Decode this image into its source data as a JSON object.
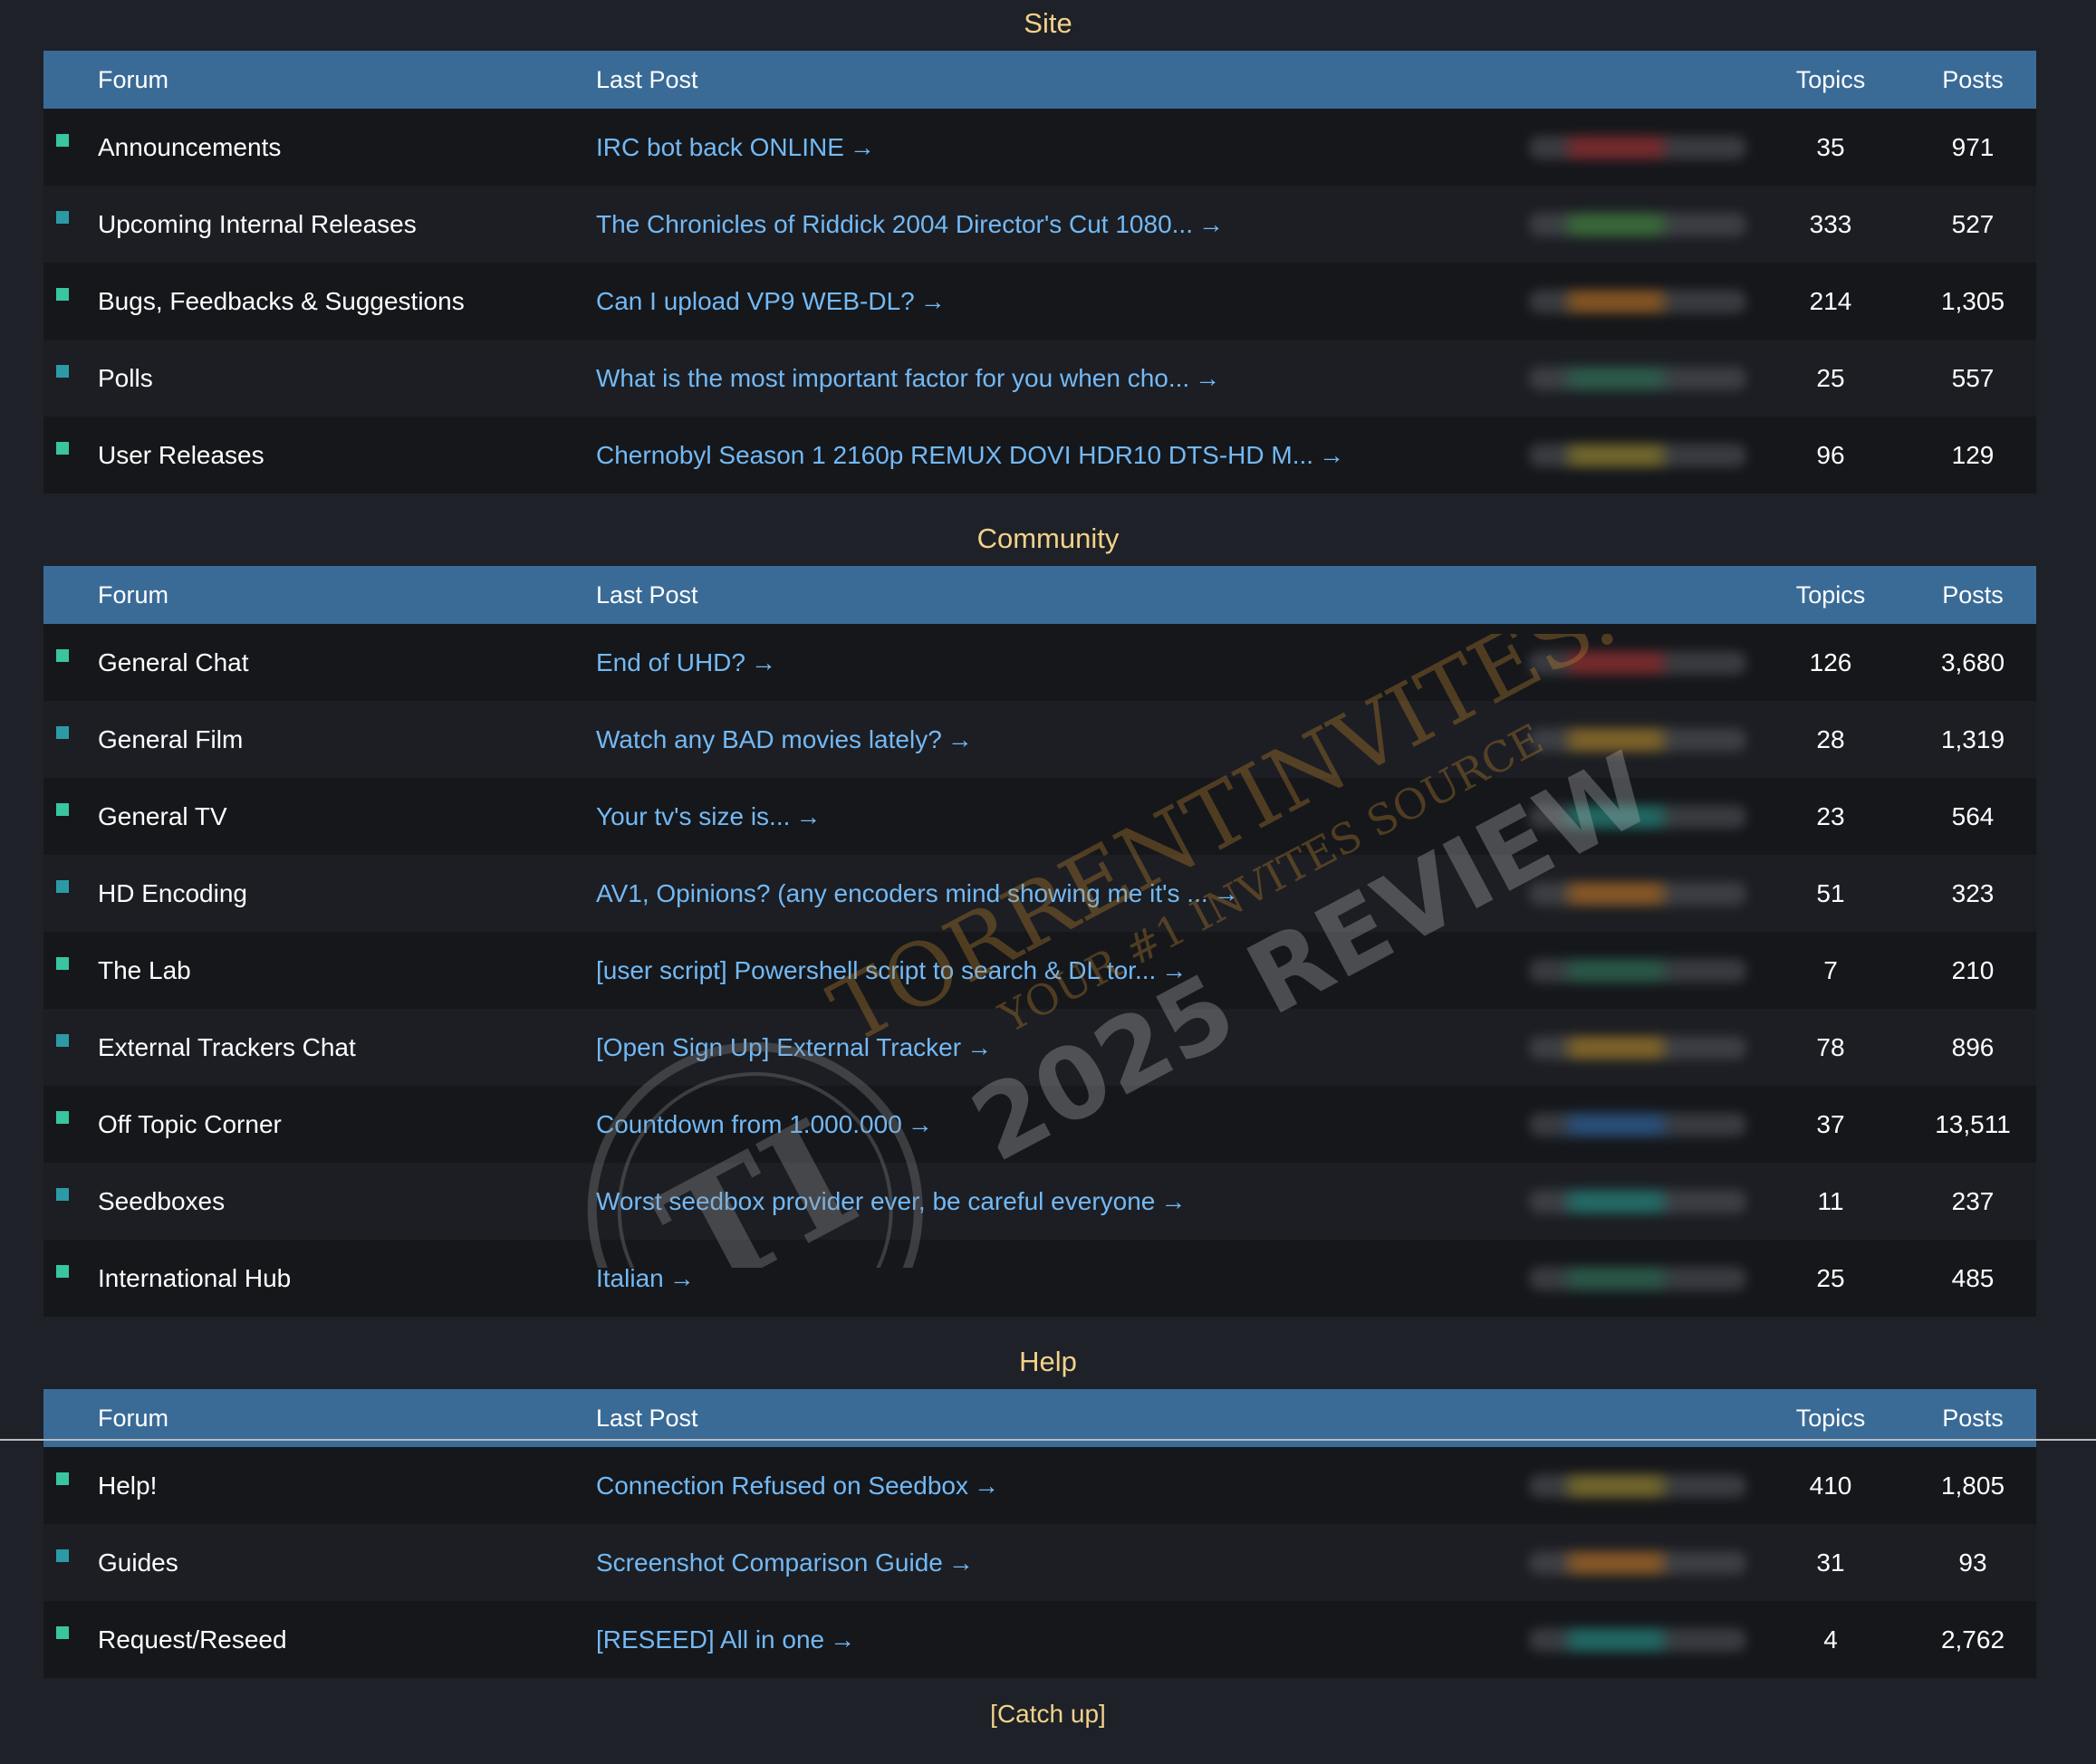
{
  "headers": {
    "forum": "Forum",
    "last_post": "Last Post",
    "topics": "Topics",
    "posts": "Posts"
  },
  "sections": [
    {
      "title": "Site",
      "rows": [
        {
          "forum": "Announcements",
          "last": "IRC bot back ONLINE",
          "topics": "35",
          "posts": "971",
          "blur": "#c23a3a"
        },
        {
          "forum": "Upcoming Internal Releases",
          "last": "The Chronicles of Riddick 2004 Director's Cut 1080...",
          "topics": "333",
          "posts": "527",
          "blur": "#4fa34a"
        },
        {
          "forum": "Bugs, Feedbacks & Suggestions",
          "last": "Can I upload VP9 WEB-DL?",
          "topics": "214",
          "posts": "1,305",
          "blur": "#d8842a"
        },
        {
          "forum": "Polls",
          "last": "What is the most important factor for you when cho...",
          "topics": "25",
          "posts": "557",
          "blur": "#3a8a6a"
        },
        {
          "forum": "User Releases",
          "last": "Chernobyl Season 1 2160p REMUX DOVI HDR10 DTS-HD M...",
          "topics": "96",
          "posts": "129",
          "blur": "#b8a23a"
        }
      ]
    },
    {
      "title": "Community",
      "rows": [
        {
          "forum": "General Chat",
          "last": "End of UHD?",
          "topics": "126",
          "posts": "3,680",
          "blur": "#c23a3a"
        },
        {
          "forum": "General Film",
          "last": "Watch any BAD movies lately?",
          "topics": "28",
          "posts": "1,319",
          "blur": "#c9982e"
        },
        {
          "forum": "General TV",
          "last": "Your tv's size is...",
          "topics": "23",
          "posts": "564",
          "blur": "#2aa69a"
        },
        {
          "forum": "HD Encoding",
          "last": "AV1, Opinions? (any encoders mind showing me it's ...",
          "topics": "51",
          "posts": "323",
          "blur": "#d8842a"
        },
        {
          "forum": "The Lab",
          "last": "[user script] Powershell script to search & DL tor...",
          "topics": "7",
          "posts": "210",
          "blur": "#3a8a6a"
        },
        {
          "forum": "External Trackers Chat",
          "last": "[Open Sign Up] External Tracker",
          "topics": "78",
          "posts": "896",
          "blur": "#c9982e"
        },
        {
          "forum": "Off Topic Corner",
          "last": "Countdown from 1.000.000",
          "topics": "37",
          "posts": "13,511",
          "blur": "#3a7ac2"
        },
        {
          "forum": "Seedboxes",
          "last": "Worst seedbox provider ever, be careful everyone",
          "topics": "11",
          "posts": "237",
          "blur": "#2aa69a"
        },
        {
          "forum": "International Hub",
          "last": "Italian",
          "topics": "25",
          "posts": "485",
          "blur": "#3a8a6a"
        }
      ]
    },
    {
      "title": "Help",
      "rows": [
        {
          "forum": "Help!",
          "last": "Connection Refused on Seedbox",
          "topics": "410",
          "posts": "1,805",
          "blur": "#b8a23a"
        },
        {
          "forum": "Guides",
          "last": "Screenshot Comparison Guide",
          "topics": "31",
          "posts": "93",
          "blur": "#d8842a"
        },
        {
          "forum": "Request/Reseed",
          "last": "[RESEED] All in one",
          "topics": "4",
          "posts": "2,762",
          "blur": "#2aa69a"
        }
      ]
    }
  ],
  "catch_up": "[Catch up]",
  "watermark": {
    "line1": "TORRENTINVITES.ORG",
    "line2": "YOUR #1 INVITES SOURCE",
    "line3": "2025 REVIEW",
    "mono": "TI"
  },
  "colors": {
    "header_bg": "#3a6b97",
    "link": "#73b9f5",
    "section_title": "#f2d28a",
    "unread": "#39c5a0"
  }
}
